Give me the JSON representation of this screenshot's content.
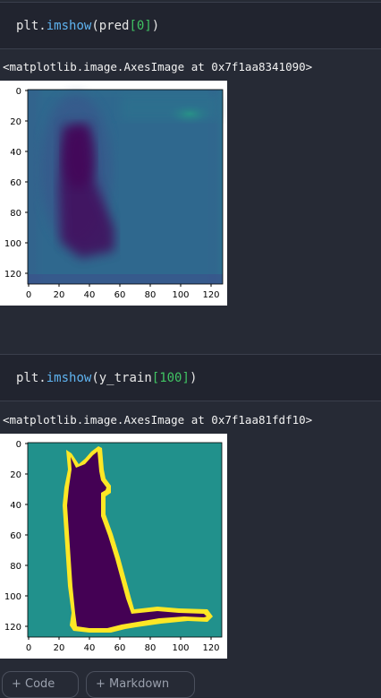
{
  "cells": [
    {
      "code": {
        "obj": "plt",
        "dot": ".",
        "fn": "imshow",
        "open": "(",
        "arg": "pred",
        "lb": "[",
        "idx": "0",
        "rb": "]",
        "close": ")"
      },
      "output_repr": "<matplotlib.image.AxesImage at 0x7f1aa8341090>",
      "plot": {
        "description": "prediction heatmap",
        "xticks": [
          "0",
          "20",
          "40",
          "60",
          "80",
          "100",
          "120"
        ],
        "yticks": [
          "0",
          "20",
          "40",
          "60",
          "80",
          "100",
          "120"
        ]
      }
    },
    {
      "code": {
        "obj": "plt",
        "dot": ".",
        "fn": "imshow",
        "open": "(",
        "arg": "y_train",
        "lb": "[",
        "idx": "100",
        "rb": "]",
        "close": ")"
      },
      "output_repr": "<matplotlib.image.AxesImage at 0x7f1aa81fdf10>",
      "plot": {
        "description": "segmentation mask of a cat",
        "xticks": [
          "0",
          "20",
          "40",
          "60",
          "80",
          "100",
          "120"
        ],
        "yticks": [
          "0",
          "20",
          "40",
          "60",
          "80",
          "100",
          "120"
        ]
      }
    }
  ],
  "buttons": {
    "add_code": "+ Code",
    "add_markdown": "+ Markdown"
  },
  "colors": {
    "background": "#262a35",
    "cell_bg": "#21242f",
    "function": "#5fb3f0",
    "number": "#40c463",
    "viridis_dark": "#440154",
    "viridis_mid": "#21918c",
    "viridis_light": "#fde725"
  }
}
